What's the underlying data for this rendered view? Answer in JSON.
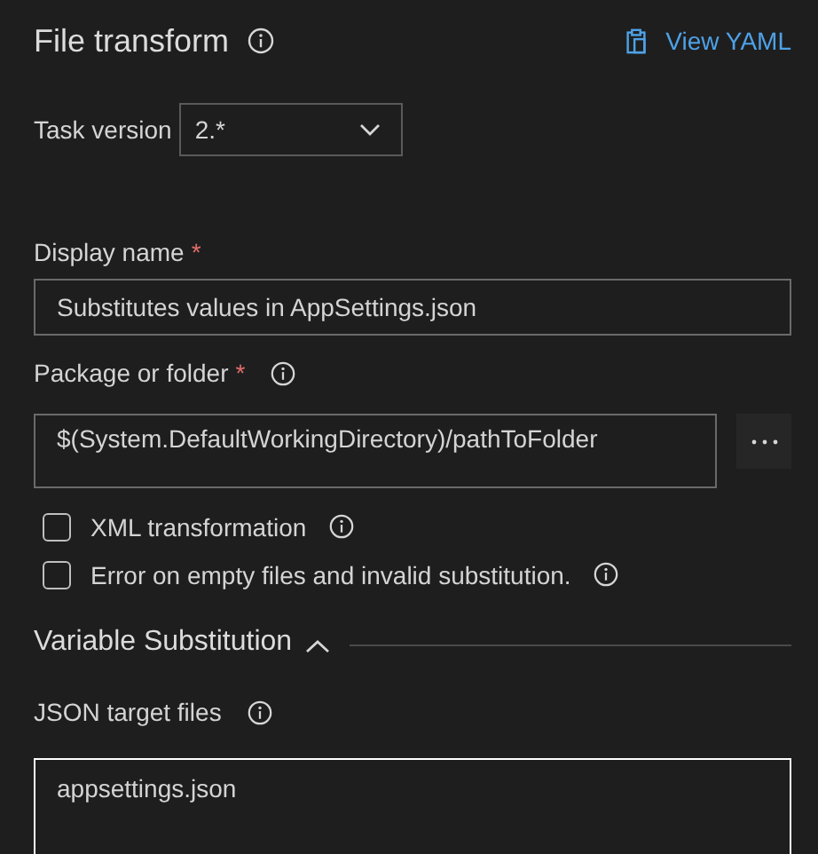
{
  "header": {
    "title": "File transform",
    "link": "View YAML"
  },
  "task_version": {
    "label": "Task version",
    "value": "2.*"
  },
  "fields": [
    {
      "kind": "input",
      "label": "Display name",
      "required_mark": "*",
      "info": false,
      "value": "Substitutes values in AppSettings.json"
    },
    {
      "kind": "browse",
      "label": "Package or folder",
      "required_mark": "*",
      "info": true,
      "value": "$(System.DefaultWorkingDirectory)/pathToFolder"
    }
  ],
  "checkboxes": [
    {
      "label": "XML transformation",
      "checked": false
    },
    {
      "label": "Error on empty files and invalid substitution.",
      "checked": false
    }
  ],
  "section": {
    "title": "Variable Substitution",
    "expanded": true,
    "fields": [
      {
        "kind": "textarea",
        "label": "JSON target files",
        "info": true,
        "value": "appsettings.json"
      }
    ]
  }
}
